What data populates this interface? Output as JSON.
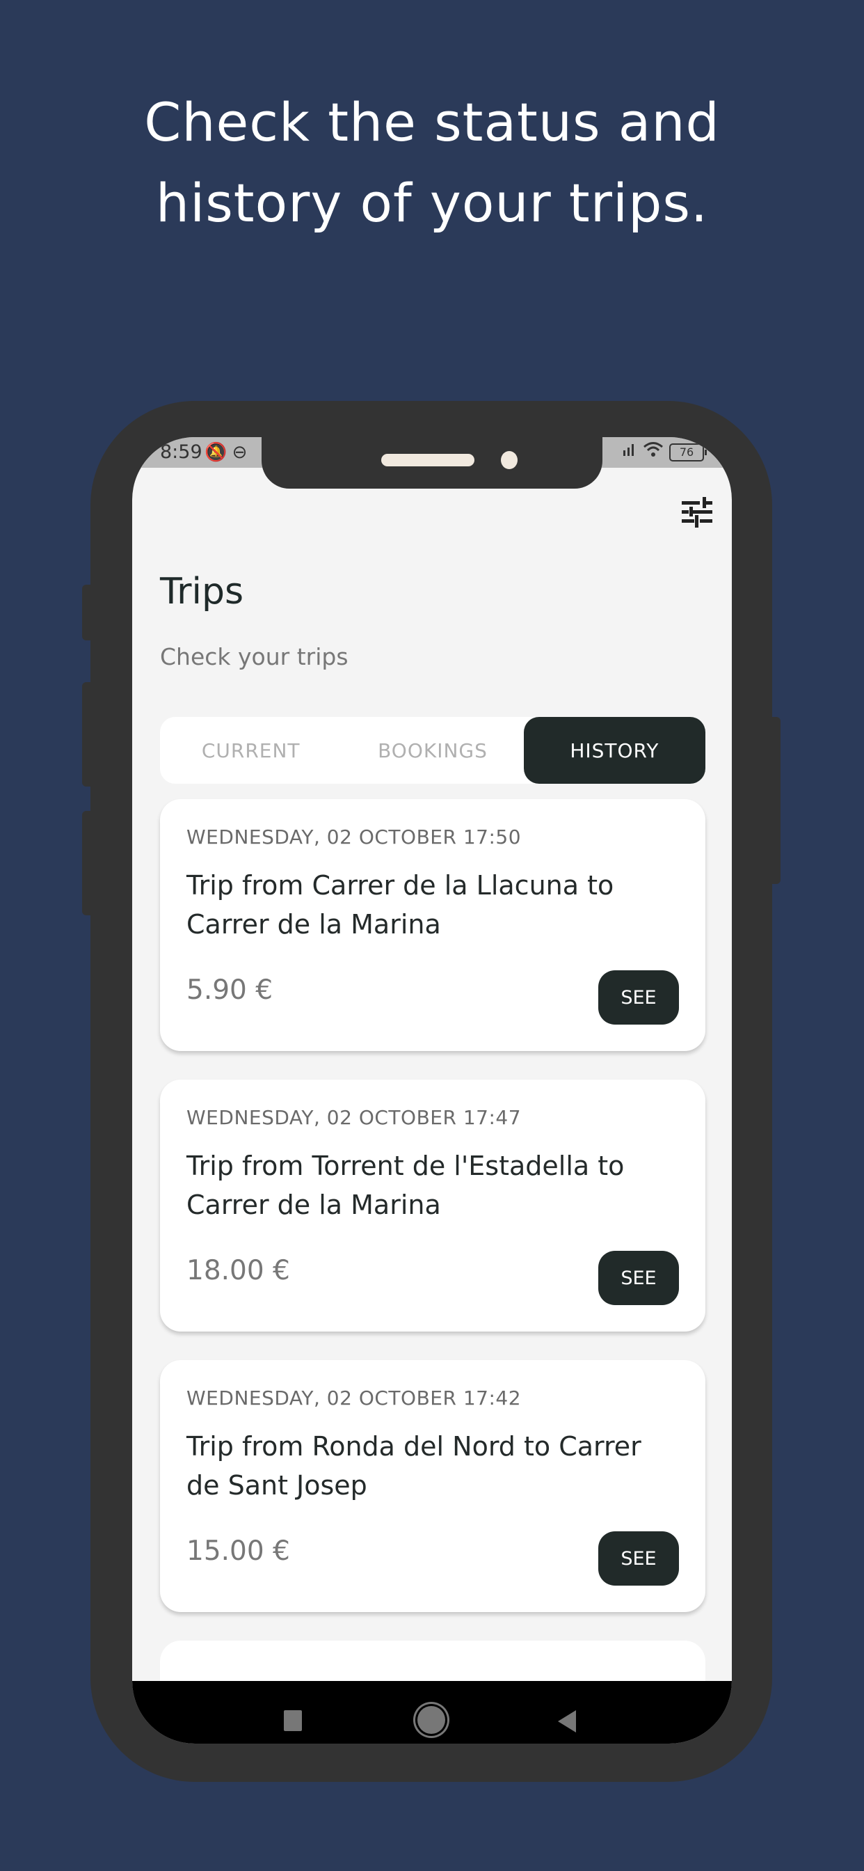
{
  "promo": {
    "headline_line1": "Check the status and",
    "headline_line2": "history of your trips."
  },
  "status_bar": {
    "time": "8:59",
    "left_icons": [
      "mute-icon",
      "steering-wheel-icon"
    ],
    "right_icons": [
      "signal-icon",
      "wifi-icon"
    ],
    "battery": "76"
  },
  "header": {
    "filter_icon": "tune-icon",
    "title": "Trips",
    "subtitle": "Check your trips"
  },
  "tabs": [
    {
      "label": "CURRENT",
      "active": false
    },
    {
      "label": "BOOKINGS",
      "active": false
    },
    {
      "label": "HISTORY",
      "active": true
    }
  ],
  "trips": [
    {
      "date": "WEDNESDAY, 02 OCTOBER 17:50",
      "title": "Trip from Carrer de la Llacuna to Carrer de la Marina",
      "price": "5.90 €",
      "action": "SEE"
    },
    {
      "date": "WEDNESDAY, 02 OCTOBER 17:47",
      "title": "Trip from Torrent de l'Estadella to Carrer de la Marina",
      "price": "18.00 €",
      "action": "SEE"
    },
    {
      "date": "WEDNESDAY, 02 OCTOBER 17:42",
      "title": "Trip from Ronda del Nord to Carrer de Sant Josep",
      "price": "15.00 €",
      "action": "SEE"
    }
  ],
  "nav_bar": [
    "recent-apps",
    "home",
    "back"
  ],
  "colors": {
    "background": "#2b3a59",
    "phone_frame": "#333333",
    "accent_dark": "#212a29",
    "screen_bg": "#f4f4f4"
  }
}
